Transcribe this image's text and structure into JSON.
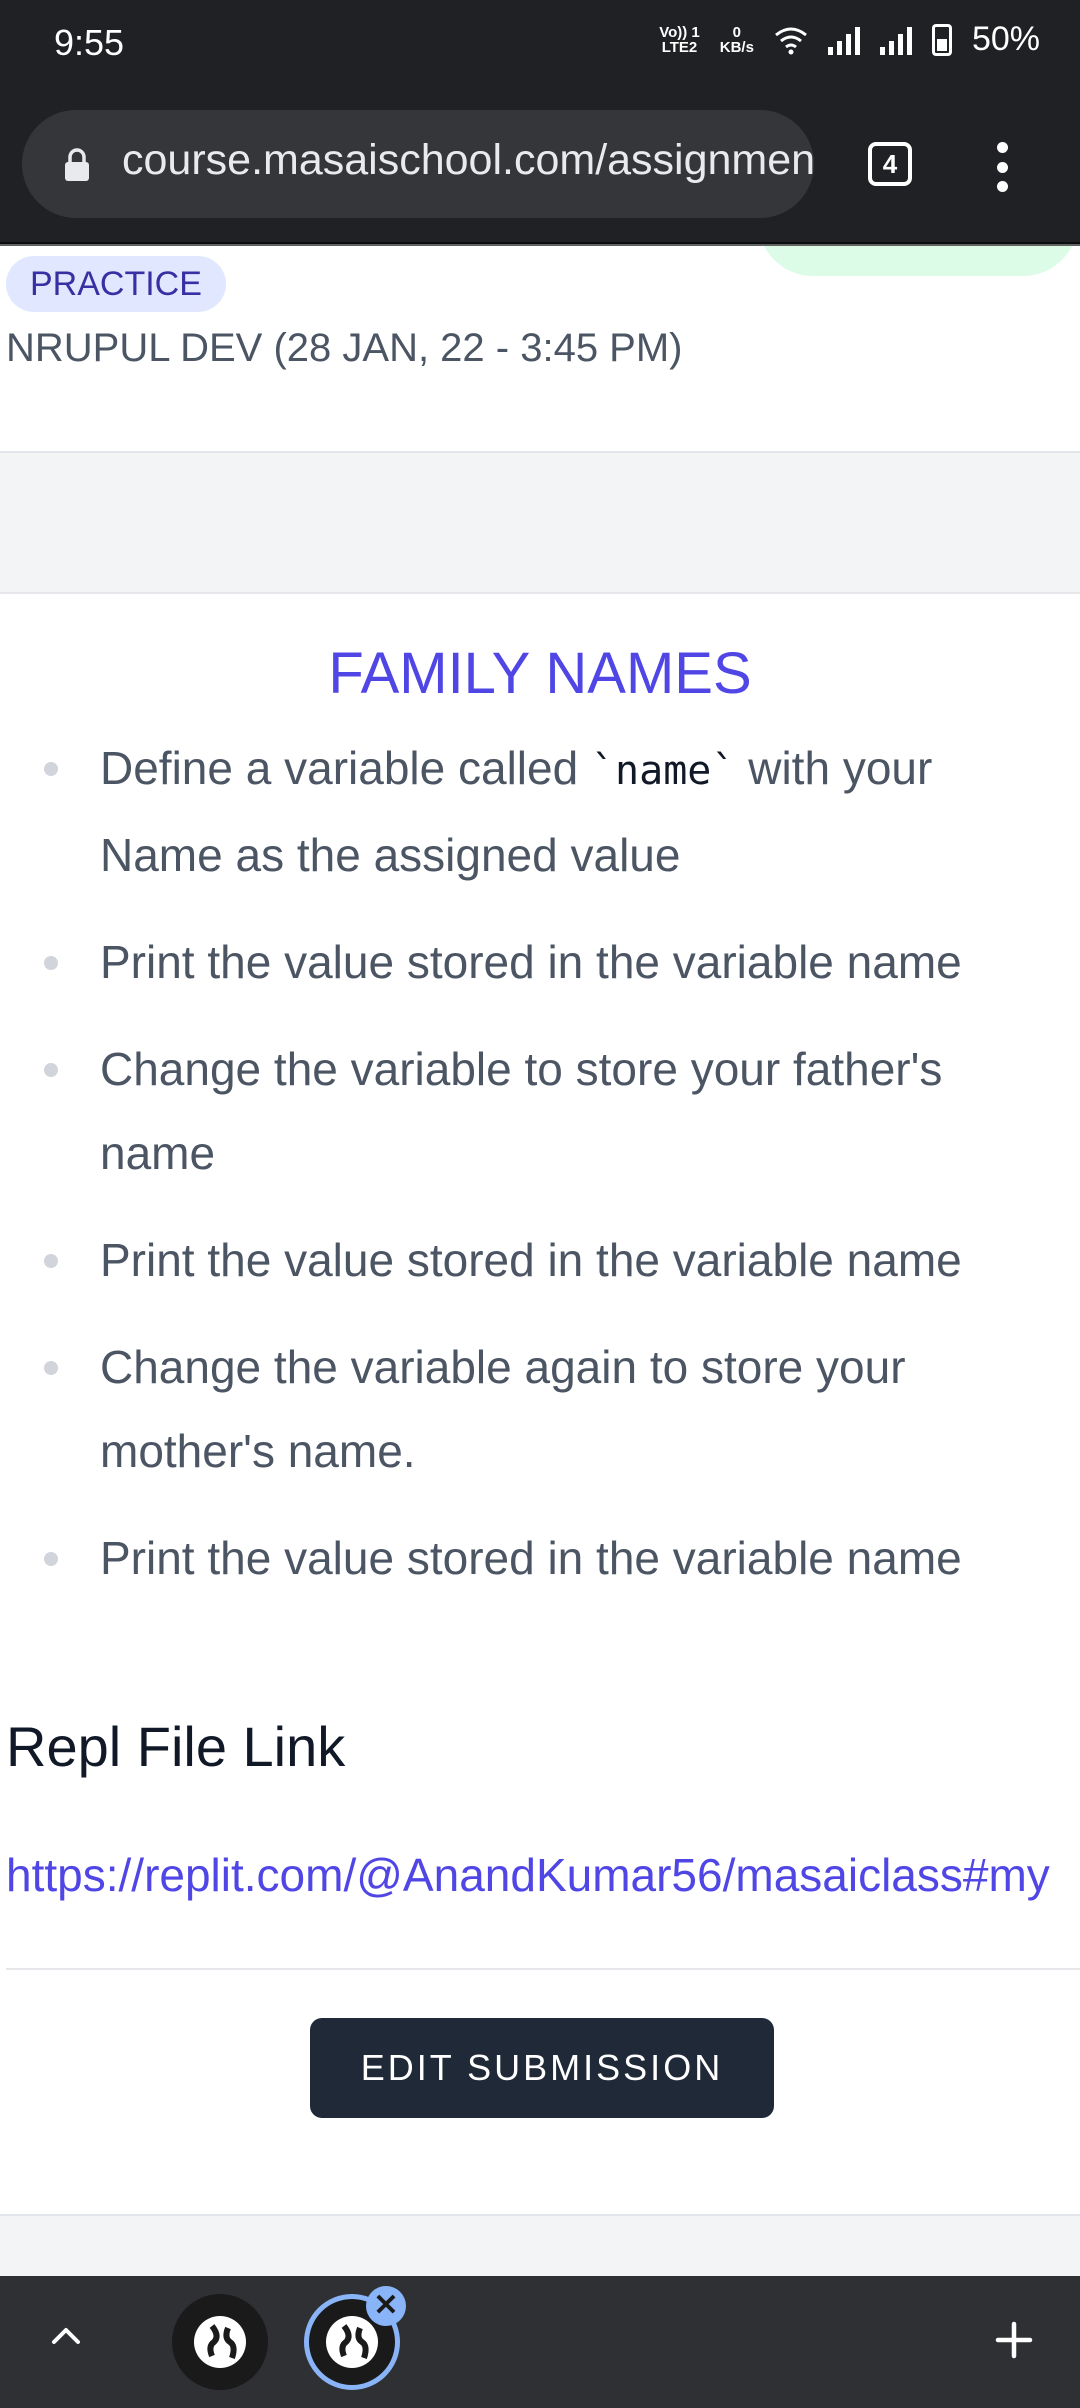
{
  "status_bar": {
    "time": "9:55",
    "network_label": "Vo)) 1",
    "network_label2": "LTE2",
    "data_rate_value": "0",
    "data_rate_unit": "KB/s",
    "battery": "50%"
  },
  "browser": {
    "url": "course.masaischool.com/assignments",
    "tab_count": "4"
  },
  "assignment": {
    "tag": "PRACTICE",
    "author_line": "NRUPUL DEV (28 JAN, 22 - 3:45 PM)"
  },
  "problem": {
    "title": "FAMILY NAMES",
    "steps": {
      "s1_before": "Define a variable called ",
      "s1_code": "`name`",
      "s1_after": " with your Name as the assigned value",
      "s2": "Print the value stored in the variable name",
      "s3": "Change the variable to store your father's name",
      "s4": "Print the value stored in the variable name",
      "s5": "Change the variable again to store your mother's name.",
      "s6": "Print the value stored in the variable name"
    }
  },
  "submission": {
    "heading": "Repl File Link",
    "link": "https://replit.com/@AnandKumar56/masaiclass#my",
    "edit_button": "EDIT SUBMISSION"
  },
  "bottom_bar": {
    "close_symbol": "✕"
  },
  "colors": {
    "accent": "#4f46e5",
    "practice_badge_bg": "#e0e7ff",
    "button_bg": "#1f2937",
    "status_badge_green": "#dcfce7"
  }
}
